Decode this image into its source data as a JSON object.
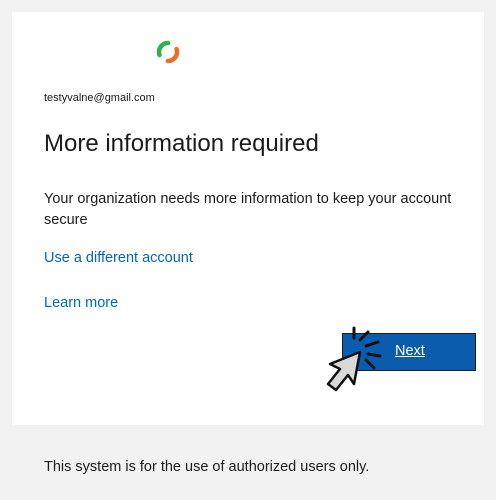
{
  "card": {
    "logo_icon": "org-logo-icon",
    "email": "testyvalne@gmail.com",
    "title": "More information required",
    "description": "Your organization needs more information to keep your account secure",
    "use_different_account_link": "Use a different account",
    "learn_more_link": "Learn more",
    "next_button": "Next"
  },
  "cursor_icon": "pointer-click-icon",
  "footer": {
    "notice": "This system is for the use of authorized users only."
  },
  "colors": {
    "link": "#0067b8",
    "button": "#0b5cad",
    "logo_green": "#2eb34a",
    "logo_orange": "#f26b22",
    "background": "#f2f2f2"
  }
}
